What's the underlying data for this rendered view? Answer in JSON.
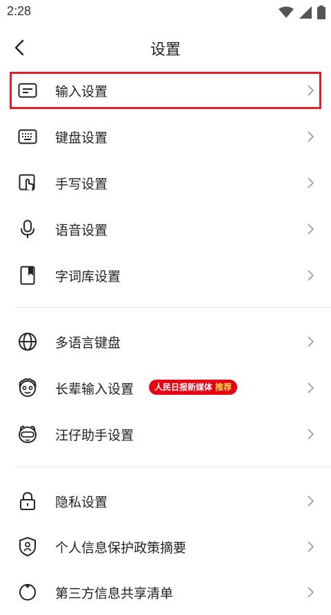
{
  "status_bar": {
    "time": "2:28"
  },
  "header": {
    "title": "设置"
  },
  "groups": [
    {
      "items": [
        {
          "label": "输入设置",
          "icon": "input-settings-icon"
        },
        {
          "label": "键盘设置",
          "icon": "keyboard-icon"
        },
        {
          "label": "手写设置",
          "icon": "handwriting-icon"
        },
        {
          "label": "语音设置",
          "icon": "microphone-icon"
        },
        {
          "label": "字词库设置",
          "icon": "dictionary-icon"
        }
      ]
    },
    {
      "items": [
        {
          "label": "多语言键盘",
          "icon": "globe-icon"
        },
        {
          "label": "长辈输入设置",
          "icon": "elder-face-icon",
          "badge_main": "人民日报新媒体",
          "badge_sub": "推荐"
        },
        {
          "label": "汪仔助手设置",
          "icon": "assistant-icon"
        }
      ]
    },
    {
      "items": [
        {
          "label": "隐私设置",
          "icon": "lock-icon"
        },
        {
          "label": "个人信息保护政策摘要",
          "icon": "shield-user-icon"
        },
        {
          "label": "第三方信息共享清单",
          "icon": "share-icon"
        }
      ]
    }
  ],
  "colors": {
    "highlight": "#e01e26",
    "badge": "#e60012"
  }
}
